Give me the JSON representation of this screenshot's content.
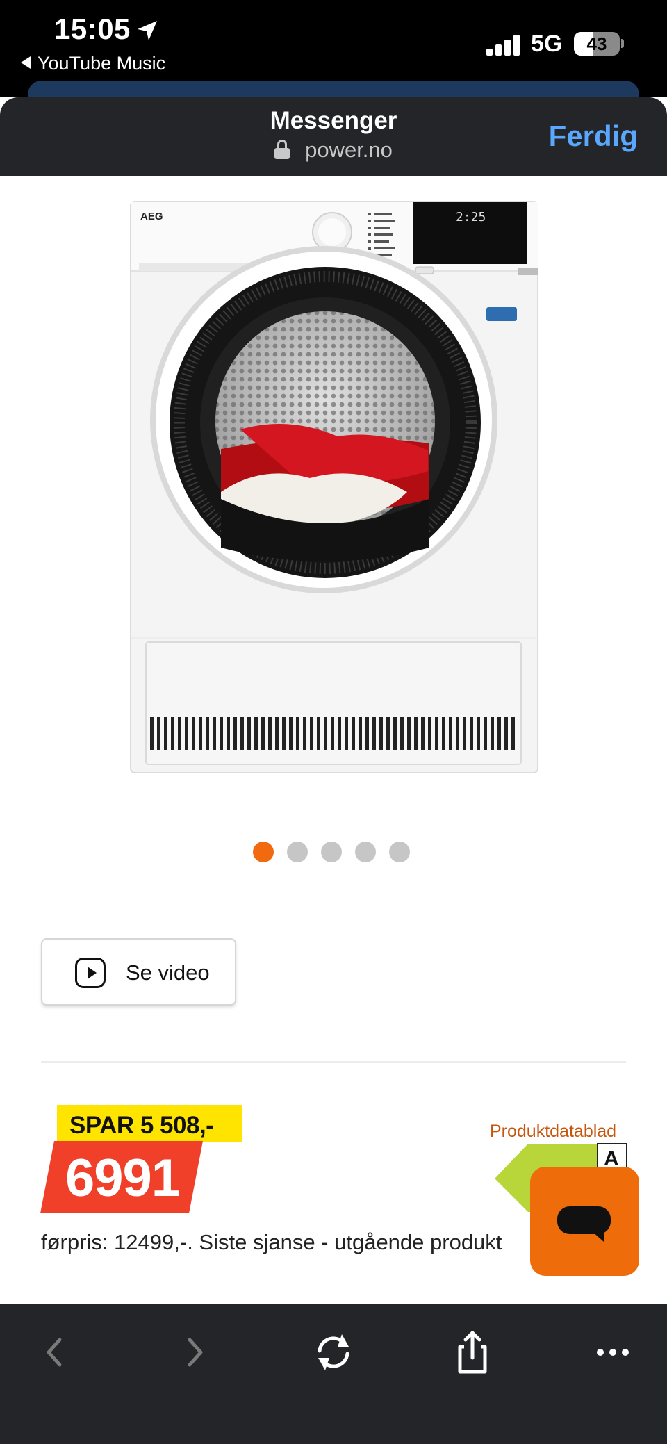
{
  "status_bar": {
    "time": "15:05",
    "back_app": "YouTube Music",
    "network": "5G",
    "battery": "43",
    "battery_level": 0.43,
    "icons": [
      "location-arrow-icon",
      "signal-bars-icon",
      "battery-icon"
    ]
  },
  "header": {
    "title": "Messenger",
    "url": "power.no",
    "done_label": "Ferdig",
    "done_color": "#5aa7ff"
  },
  "product": {
    "image_name": "aeg-tumble-dryer",
    "brand": "AEG",
    "display_time": "2:25"
  },
  "carousel": {
    "count": 5,
    "active_index": 0,
    "active_color": "#f26a10"
  },
  "video_button": {
    "label": "Se video",
    "icon": "play-icon"
  },
  "pricing": {
    "savings": "SPAR 5 508,-",
    "price": "6991",
    "datasheet_link": "Produktdatablad",
    "energy_class": "A",
    "previous_price_note": "førpris: 12499,-. Siste sjanse - utgående produkt",
    "price_color": "#f0402a",
    "savings_color": "#ffe400"
  },
  "chat_button": {
    "icon": "chat-bubble-icon",
    "color": "#ef6c0b"
  },
  "toolbar": {
    "icons": [
      "back-icon",
      "forward-icon",
      "reload-icon",
      "share-icon",
      "more-icon"
    ]
  }
}
